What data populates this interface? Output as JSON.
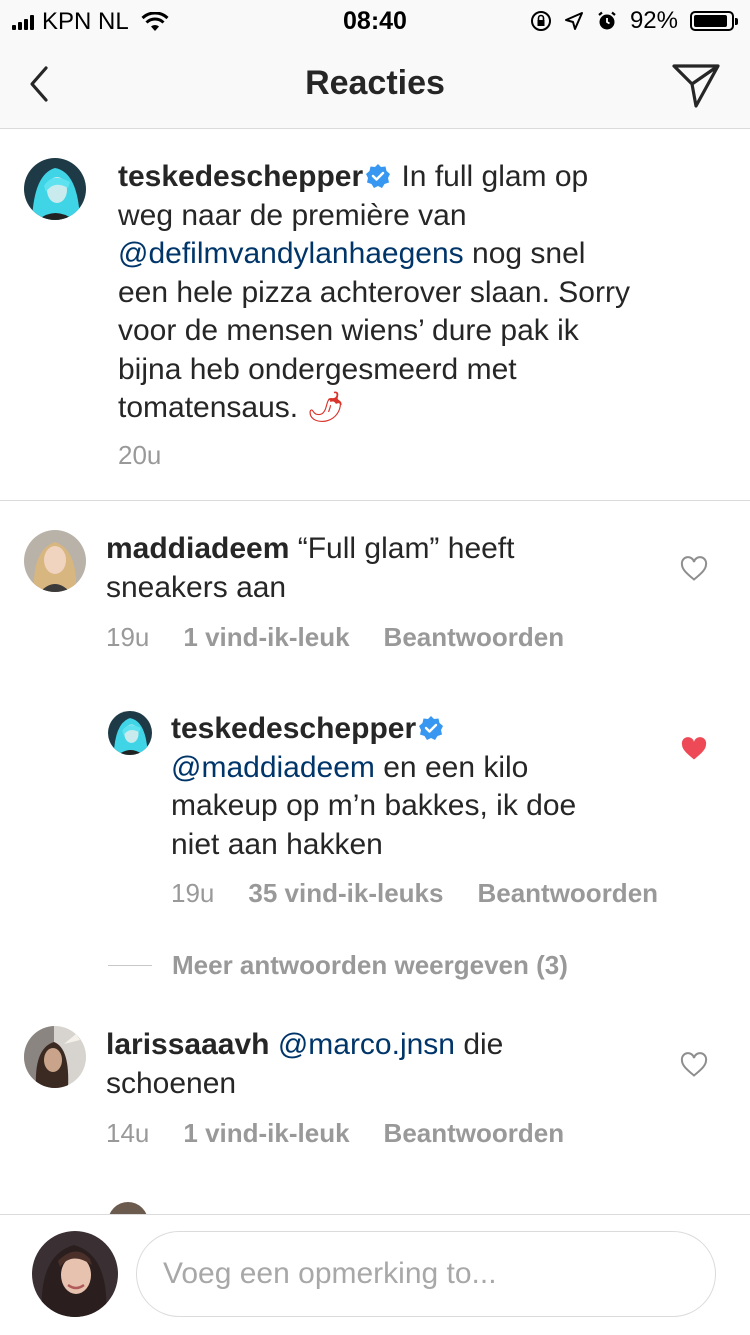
{
  "status_bar": {
    "carrier": "KPN NL",
    "time": "08:40",
    "battery_percent": "92%",
    "battery_level": 0.92,
    "icons": [
      "signal-icon",
      "wifi-icon",
      "orientation-lock-icon",
      "location-arrow-icon",
      "alarm-icon",
      "battery-icon"
    ]
  },
  "header": {
    "title": "Reacties",
    "back_icon": "chevron-left-icon",
    "share_icon": "paper-plane-icon"
  },
  "caption": {
    "username": "teskedeschepper",
    "verified": true,
    "text_before": " In full glam op weg naar de première van ",
    "mention": "@defilmvandylanhaegens",
    "text_after": " nog snel een hele pizza achterover slaan. Sorry voor de mensen wiens’ dure pak ik bijna heb ondergesmeerd met tomatensaus. ",
    "emoji": "🌶",
    "time": "20u"
  },
  "comments": [
    {
      "username": "maddiadeem",
      "text": " “Full glam” heeft sneakers aan",
      "time": "19u",
      "likes": "1 vind-ik-leuk",
      "reply_label": "Beantwoorden",
      "liked": false
    },
    {
      "username": "larissaaavh",
      "mention": "@marco.jnsn",
      "text": " die schoenen",
      "time": "14u",
      "likes": "1 vind-ik-leuk",
      "reply_label": "Beantwoorden",
      "liked": false
    }
  ],
  "reply": {
    "username": "teskedeschepper",
    "verified": true,
    "mention": "@maddiadeem",
    "text": " en een kilo makeup op m’n bakkes, ik doe niet aan hakken",
    "time": "19u",
    "likes": "35 vind-ik-leuks",
    "reply_label": "Beantwoorden",
    "liked": true
  },
  "more_replies": "Meer antwoorden weergeven (3)",
  "composer": {
    "placeholder": "Voeg een opmerking to..."
  },
  "colors": {
    "mention": "#003569",
    "verified_badge": "#3897f0",
    "liked_heart": "#ed4956",
    "secondary_text": "#999999"
  }
}
